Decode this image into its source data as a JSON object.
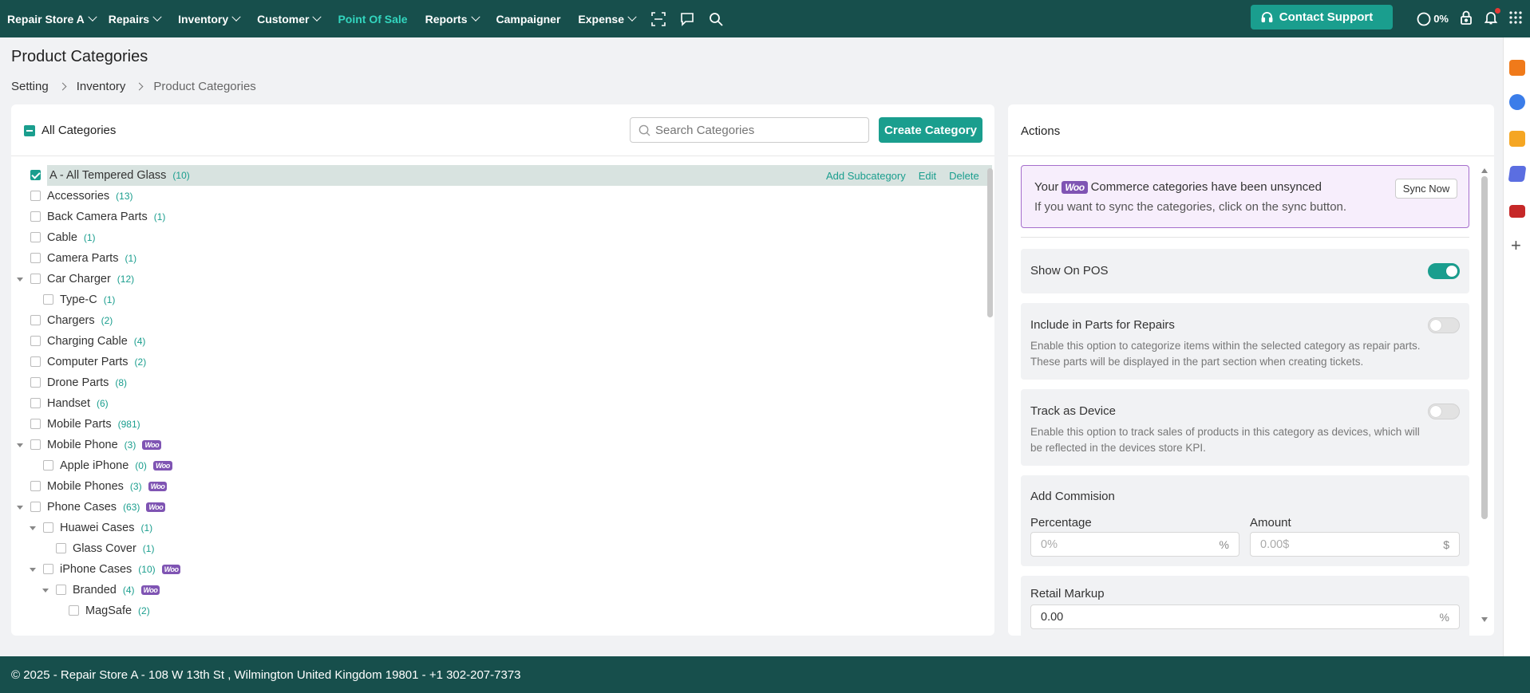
{
  "nav": {
    "store": "Repair Store A",
    "items": [
      {
        "label": "Repairs",
        "dropdown": true
      },
      {
        "label": "Inventory",
        "dropdown": true
      },
      {
        "label": "Customer",
        "dropdown": true
      },
      {
        "label": "Point Of Sale",
        "dropdown": false,
        "active": true
      },
      {
        "label": "Reports",
        "dropdown": true
      },
      {
        "label": "Campaigner",
        "dropdown": false
      },
      {
        "label": "Expense",
        "dropdown": true
      }
    ],
    "icons": [
      "scan-icon",
      "chat-icon",
      "search-icon"
    ],
    "contact_support": "Contact Support",
    "progress_label": "0%",
    "accent": "#33d6bf",
    "bar_color": "#174f4c"
  },
  "page": {
    "title": "Product Categories",
    "breadcrumb": [
      "Setting",
      "Inventory",
      "Product Categories"
    ]
  },
  "categories": {
    "all_label": "All Categories",
    "search_placeholder": "Search Categories",
    "create_button": "Create Category",
    "row_actions": {
      "add": "Add Subcategory",
      "edit": "Edit",
      "delete": "Delete"
    },
    "woo_badge": "Woo",
    "items": [
      {
        "name": "A - All Tempered Glass",
        "count": "(10)",
        "level": 0,
        "checked": true,
        "selected": true,
        "expand": false,
        "woo": false
      },
      {
        "name": "Accessories",
        "count": "(13)",
        "level": 0,
        "expand": false,
        "woo": false
      },
      {
        "name": "Back Camera Parts",
        "count": "(1)",
        "level": 0,
        "expand": false,
        "woo": false
      },
      {
        "name": "Cable",
        "count": "(1)",
        "level": 0,
        "expand": false,
        "woo": false
      },
      {
        "name": "Camera Parts",
        "count": "(1)",
        "level": 0,
        "expand": false,
        "woo": false
      },
      {
        "name": "Car Charger",
        "count": "(12)",
        "level": 0,
        "expand": true,
        "woo": false
      },
      {
        "name": "Type-C",
        "count": "(1)",
        "level": 1,
        "expand": false,
        "woo": false
      },
      {
        "name": "Chargers",
        "count": "(2)",
        "level": 0,
        "expand": false,
        "woo": false
      },
      {
        "name": "Charging Cable",
        "count": "(4)",
        "level": 0,
        "expand": false,
        "woo": false
      },
      {
        "name": "Computer Parts",
        "count": "(2)",
        "level": 0,
        "expand": false,
        "woo": false
      },
      {
        "name": "Drone Parts",
        "count": "(8)",
        "level": 0,
        "expand": false,
        "woo": false
      },
      {
        "name": "Handset",
        "count": "(6)",
        "level": 0,
        "expand": false,
        "woo": false
      },
      {
        "name": "Mobile Parts",
        "count": "(981)",
        "level": 0,
        "expand": false,
        "woo": false
      },
      {
        "name": "Mobile Phone",
        "count": "(3)",
        "level": 0,
        "expand": true,
        "woo": true
      },
      {
        "name": "Apple iPhone",
        "count": "(0)",
        "level": 1,
        "expand": false,
        "woo": true
      },
      {
        "name": "Mobile Phones",
        "count": "(3)",
        "level": 0,
        "expand": false,
        "woo": true
      },
      {
        "name": "Phone Cases",
        "count": "(63)",
        "level": 0,
        "expand": true,
        "woo": true
      },
      {
        "name": "Huawei Cases",
        "count": "(1)",
        "level": 1,
        "expand": true,
        "woo": false
      },
      {
        "name": "Glass Cover",
        "count": "(1)",
        "level": 2,
        "expand": false,
        "woo": false
      },
      {
        "name": "iPhone Cases",
        "count": "(10)",
        "level": 1,
        "expand": true,
        "woo": true
      },
      {
        "name": "Branded",
        "count": "(4)",
        "level": 2,
        "expand": true,
        "woo": true
      },
      {
        "name": "MagSafe",
        "count": "(2)",
        "level": 3,
        "expand": false,
        "woo": false
      }
    ]
  },
  "actions": {
    "title": "Actions",
    "unsynced": {
      "prefix": "Your",
      "woo": "Woo",
      "suffix": "Commerce categories have been unsynced",
      "line2": "If you want to sync the categories, click on the sync button.",
      "button": "Sync Now"
    },
    "show_on_pos": {
      "label": "Show On POS",
      "on": true
    },
    "include_parts": {
      "label": "Include in Parts for Repairs",
      "on": false,
      "desc": "Enable this option to categorize items within the selected category as repair parts. These parts will be displayed in the part section when creating tickets."
    },
    "track_device": {
      "label": "Track as Device",
      "on": false,
      "desc": "Enable this option to track sales of products in this category as devices, which will be reflected in the devices store KPI."
    },
    "commission": {
      "title": "Add Commision",
      "percentage_label": "Percentage",
      "percentage_placeholder": "0%",
      "percentage_suffix": "%",
      "amount_label": "Amount",
      "amount_placeholder": "0.00$",
      "amount_suffix": "$"
    },
    "markup": {
      "label": "Retail Markup",
      "value": "0.00",
      "suffix": "%"
    }
  },
  "footer": {
    "text": "© 2025 - Repair Store A - 108 W 13th St , Wilmington United Kingdom 19801 - +1 302-207-7373"
  }
}
